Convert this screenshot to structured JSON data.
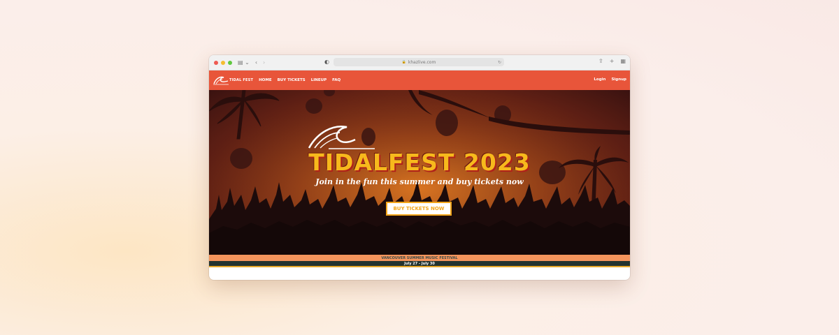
{
  "browser": {
    "url": "khazlive.com",
    "traffic_lights": [
      "#ee5a52",
      "#f5bd2f",
      "#5fc83f"
    ]
  },
  "nav": {
    "logo_text": "TIDAL FEST",
    "links": [
      "HOME",
      "BUY TICKETS",
      "LINEUP",
      "FAQ"
    ],
    "login": "Login",
    "signup": "Signup",
    "background": "#e8553a"
  },
  "hero": {
    "title": "TIDALFEST 2023",
    "subtitle": "Join in the fun this summer and buy tickets now",
    "cta_label": "BUY TICKETS NOW",
    "title_color": "#f7b91c",
    "cta_color": "#f2a51a"
  },
  "footer": {
    "line1": "VANCOUVER SUMMER MUSIC FESTIVAL",
    "line2": "July 27 - July 30"
  }
}
